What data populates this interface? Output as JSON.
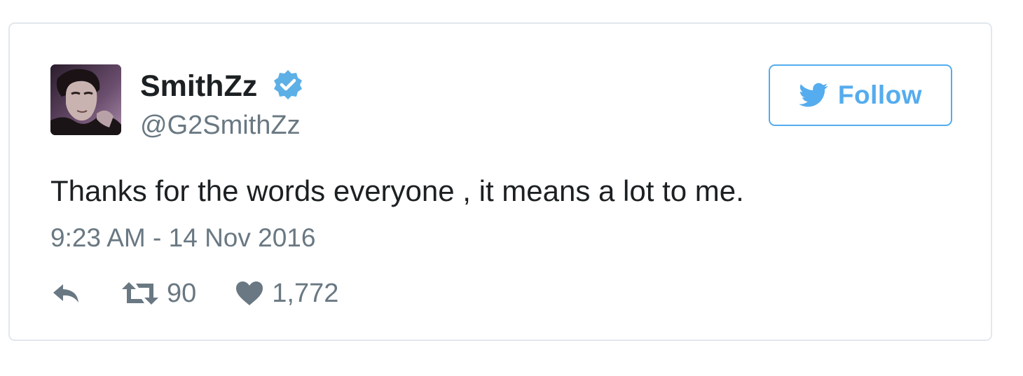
{
  "tweet": {
    "author": {
      "display_name": "SmithZz",
      "handle": "@G2SmithZz",
      "verified": true,
      "avatar_icon": "profile-photo"
    },
    "follow_button": {
      "label": "Follow",
      "icon": "twitter-bird-icon"
    },
    "text": "Thanks for the words everyone , it means a lot to me.",
    "timestamp": "9:23 AM - 14 Nov 2016",
    "actions": {
      "reply_icon": "reply-icon",
      "retweet_icon": "retweet-icon",
      "retweet_count": "90",
      "like_icon": "heart-icon",
      "like_count": "1,772"
    }
  },
  "colors": {
    "accent": "#55acee",
    "verified": "#5db0e6",
    "text_primary": "#1c2022",
    "text_secondary": "#697882",
    "border": "#e1e8ed"
  }
}
